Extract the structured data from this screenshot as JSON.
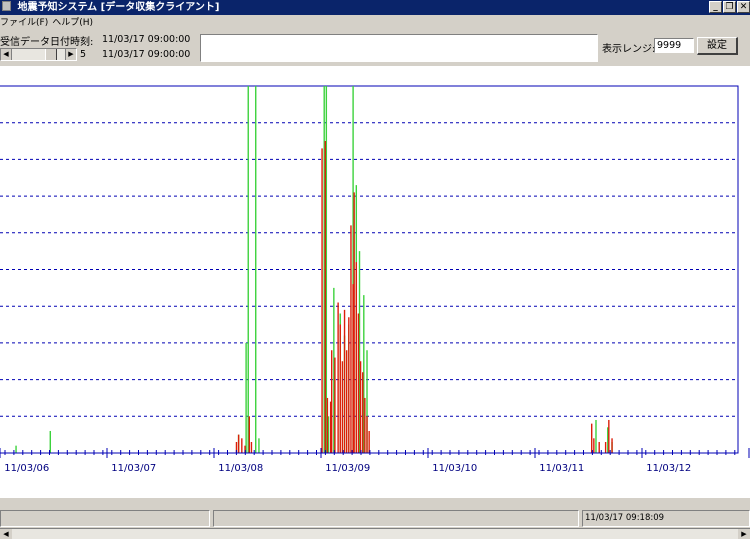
{
  "window": {
    "title": "地震予知システム [データ収集クライアント]",
    "buttons": [
      "_",
      "❐",
      "✕"
    ]
  },
  "menu": [
    "ファイル(F)",
    "ヘルプ(H)"
  ],
  "info": {
    "received_label": "受信データ日付時刻:",
    "received_time": "11/03/17 09:00:00",
    "slider_value": "5",
    "slider_time": "11/03/17 09:00:00"
  },
  "range": {
    "label": "表示レンジ:",
    "value": "9999",
    "button": "設定"
  },
  "status": {
    "time": "11/03/17 09:18:09"
  },
  "colors": {
    "green": "#3cd23c",
    "red": "#dc1e0a",
    "grid": "#0000b4",
    "tick_label": "#000080"
  },
  "chart_data": {
    "type": "bar",
    "ylim": [
      0,
      9999
    ],
    "grid": "dashed horizontal",
    "xticklabels": [
      "11/03/06",
      "11/03/07",
      "11/03/08",
      "11/03/09",
      "11/03/10",
      "11/03/11",
      "11/03/12"
    ],
    "series": [
      {
        "color": "green",
        "points": [
          [
            0.15,
            200
          ],
          [
            0.47,
            600
          ],
          [
            2.23,
            500
          ],
          [
            2.3,
            3000
          ],
          [
            2.32,
            9999
          ],
          [
            2.39,
            9999
          ],
          [
            2.42,
            400
          ],
          [
            3.03,
            9999
          ],
          [
            3.05,
            9999
          ],
          [
            3.07,
            1000
          ],
          [
            3.12,
            4500
          ],
          [
            3.18,
            3800
          ],
          [
            3.22,
            3200
          ],
          [
            3.26,
            3500
          ],
          [
            3.3,
            9999
          ],
          [
            3.33,
            7300
          ],
          [
            3.36,
            5500
          ],
          [
            3.4,
            4300
          ],
          [
            3.43,
            2800
          ],
          [
            5.57,
            900
          ],
          [
            5.68,
            700
          ],
          [
            5.72,
            300
          ]
        ]
      },
      {
        "color": "red",
        "points": [
          [
            2.21,
            300
          ],
          [
            2.23,
            500
          ],
          [
            2.26,
            400
          ],
          [
            2.29,
            200
          ],
          [
            2.33,
            1000
          ],
          [
            2.35,
            300
          ],
          [
            3.01,
            8300
          ],
          [
            3.04,
            8500
          ],
          [
            3.06,
            1500
          ],
          [
            3.09,
            1400
          ],
          [
            3.1,
            2800
          ],
          [
            3.13,
            2600
          ],
          [
            3.16,
            4100
          ],
          [
            3.18,
            3500
          ],
          [
            3.2,
            2500
          ],
          [
            3.22,
            3900
          ],
          [
            3.24,
            2800
          ],
          [
            3.26,
            3700
          ],
          [
            3.28,
            6200
          ],
          [
            3.3,
            4600
          ],
          [
            3.31,
            7100
          ],
          [
            3.33,
            5200
          ],
          [
            3.35,
            3800
          ],
          [
            3.37,
            2500
          ],
          [
            3.39,
            2200
          ],
          [
            3.41,
            1500
          ],
          [
            3.43,
            1000
          ],
          [
            3.45,
            600
          ],
          [
            5.53,
            800
          ],
          [
            5.55,
            400
          ],
          [
            5.6,
            300
          ],
          [
            5.66,
            300
          ],
          [
            5.69,
            900
          ],
          [
            5.72,
            400
          ]
        ]
      }
    ]
  }
}
